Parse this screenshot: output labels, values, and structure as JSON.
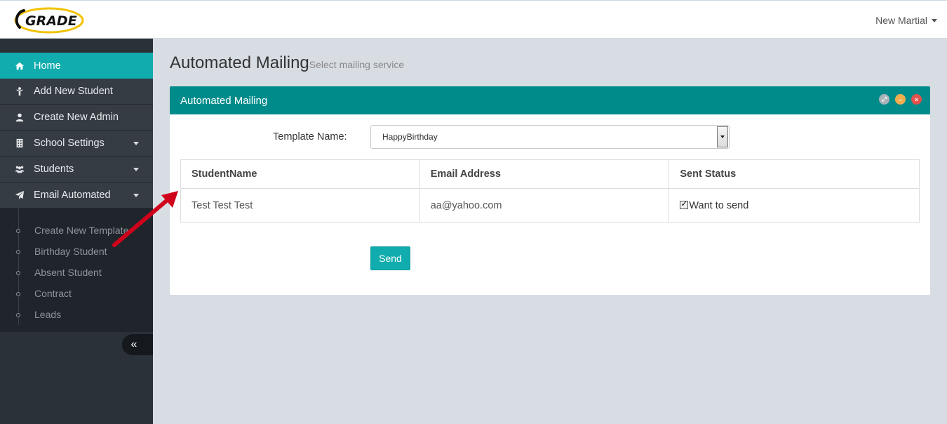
{
  "navbar": {
    "logo_text": "GRADE",
    "user_name": "New Martial"
  },
  "sidebar": {
    "items": [
      {
        "label": "Home",
        "icon": "home-icon"
      },
      {
        "label": "Add New Student",
        "icon": "student-icon"
      },
      {
        "label": "Create New Admin",
        "icon": "user-icon"
      },
      {
        "label": "School Settings",
        "icon": "building-icon"
      },
      {
        "label": "Students",
        "icon": "users-icon"
      },
      {
        "label": "Email Automated",
        "icon": "paper-plane-icon"
      }
    ],
    "submenu": [
      "Create New Template",
      "Birthday Student",
      "Absent Student",
      "Contract",
      "Leads"
    ],
    "collapse_label": "«"
  },
  "page": {
    "title": "Automated Mailing",
    "subtitle": "Select mailing service"
  },
  "panel": {
    "title": "Automated Mailing",
    "template_label": "Template Name:",
    "template_value": "HappyBirthday",
    "table": {
      "headers": [
        "StudentName",
        "Email Address",
        "Sent Status"
      ],
      "rows": [
        {
          "name": "Test Test Test",
          "email": "aa@yahoo.com",
          "status": "Want to send",
          "checked": true
        }
      ]
    },
    "send_label": "Send"
  },
  "colors": {
    "accent": "#11acad",
    "panel_header": "#008b8b",
    "sidebar_bg": "#2b3138"
  }
}
